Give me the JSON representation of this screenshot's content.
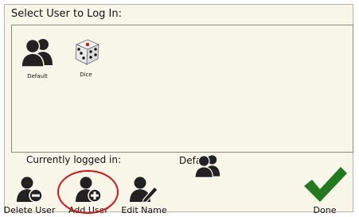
{
  "dialog": {
    "title": "Select User to Log In:"
  },
  "users": [
    {
      "name": "Default",
      "icon": "user-icon"
    },
    {
      "name": "Dice",
      "icon": "dice-icon"
    }
  ],
  "status": {
    "currently_logged_in_label": "Currently logged in:",
    "current_user": "Default"
  },
  "actions": {
    "delete_user": "Delete User",
    "add_user": "Add User",
    "edit_name": "Edit Name",
    "done": "Done"
  },
  "colors": {
    "panel_bg": "#f8f5e9",
    "highlight_circle": "#d61515",
    "done_check": "#237a1e",
    "icon": "#222222"
  }
}
